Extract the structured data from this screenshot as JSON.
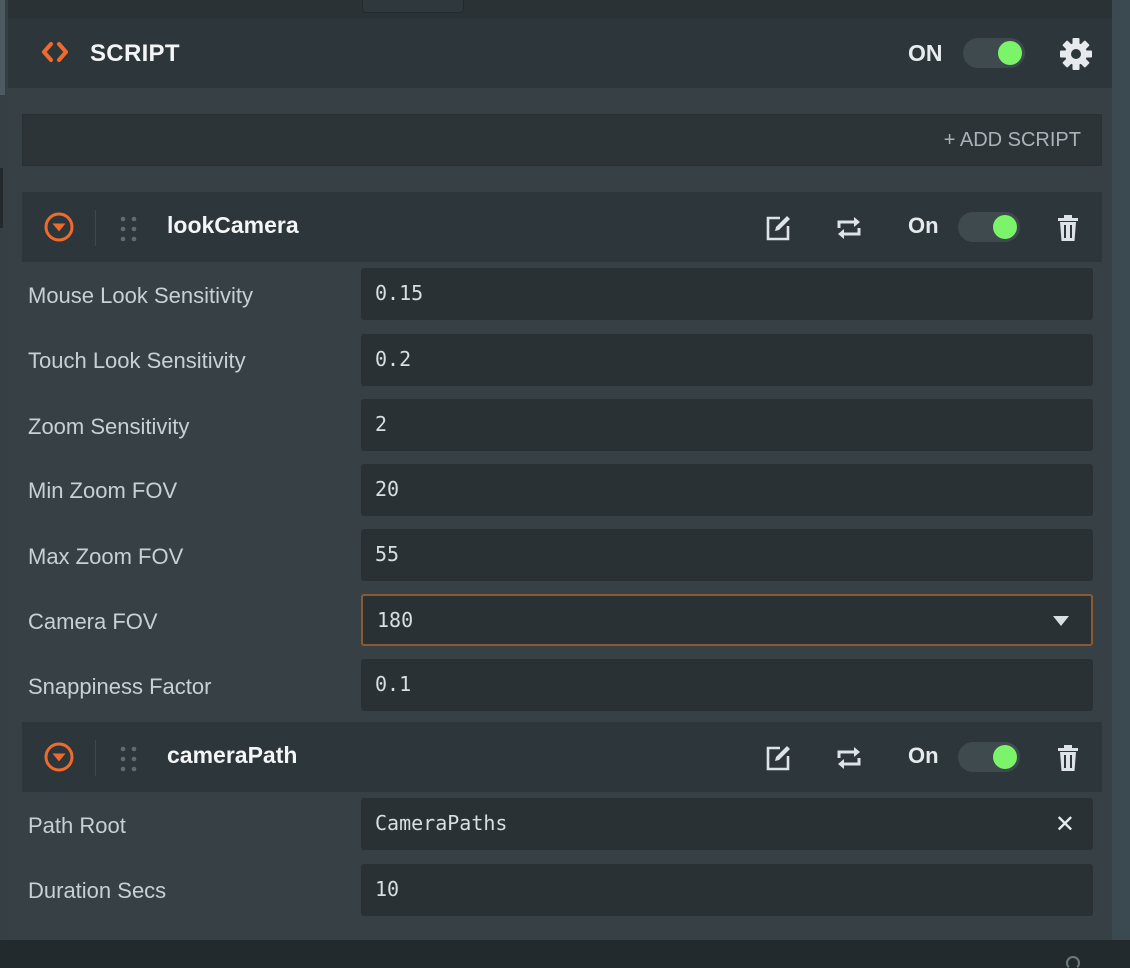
{
  "panel": {
    "title": "SCRIPT",
    "enabled_label": "ON",
    "add_script_label": "+ ADD SCRIPT"
  },
  "scripts": [
    {
      "name": "lookCamera",
      "enabled_label": "On",
      "attributes": [
        {
          "label": "Mouse Look Sensitivity",
          "value": "0.15"
        },
        {
          "label": "Touch Look Sensitivity",
          "value": "0.2"
        },
        {
          "label": "Zoom Sensitivity",
          "value": "2"
        },
        {
          "label": "Min Zoom FOV",
          "value": "20"
        },
        {
          "label": "Max Zoom FOV",
          "value": "55"
        },
        {
          "label": "Camera FOV",
          "value": "180"
        },
        {
          "label": "Snappiness Factor",
          "value": "0.1"
        }
      ]
    },
    {
      "name": "cameraPath",
      "enabled_label": "On",
      "attributes": [
        {
          "label": "Path Root",
          "value": "CameraPaths"
        },
        {
          "label": "Duration Secs",
          "value": "10"
        }
      ]
    }
  ],
  "colors": {
    "accent_orange": "#ef6a2d",
    "toggle_on_green": "#7cf46a",
    "panel_bg": "#364045",
    "field_bg": "#293135"
  },
  "icons": {
    "panel": "code-brackets-icon",
    "settings": "gear-icon",
    "collapse": "collapse-arrow-icon",
    "drag": "drag-handle-icon",
    "edit": "edit-icon",
    "reload": "reload-icon",
    "delete": "trash-icon",
    "clear": "clear-icon",
    "dropdown": "chevron-down-icon"
  }
}
